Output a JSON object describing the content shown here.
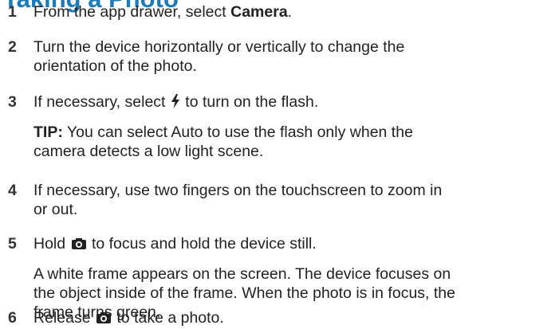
{
  "title": "Taking a Photo",
  "steps": [
    {
      "num": "1",
      "pre": "From the app drawer, select ",
      "bold": "Camera",
      "post": "."
    },
    {
      "num": "2",
      "line1": "Turn the device horizontally or vertically to change the",
      "line2": "orientation of the photo."
    },
    {
      "num": "3",
      "pre": "If necessary, select ",
      "post": " to turn on the flash.",
      "icon": "flash-icon",
      "tip_label": "TIP:",
      "tip_line1": " You can select Auto to use the flash only when the",
      "tip_line2": "camera detects a low light scene."
    },
    {
      "num": "4",
      "line1": "If necessary, use two fingers on the touchscreen to zoom in",
      "line2": "or out."
    },
    {
      "num": "5",
      "pre": "Hold ",
      "post": " to focus and hold the device still.",
      "icon": "camera-shutter-icon",
      "note_line1": "A white frame appears on the screen. The device focuses on",
      "note_line2": "the object inside of the frame. When the photo is in focus, the",
      "note_line3": "frame turns green."
    },
    {
      "num": "6",
      "pre": "Release ",
      "post": " to take a photo.",
      "icon": "camera-shutter-icon"
    }
  ],
  "colors": {
    "heading": "#1b7ab8",
    "text": "#222222"
  }
}
